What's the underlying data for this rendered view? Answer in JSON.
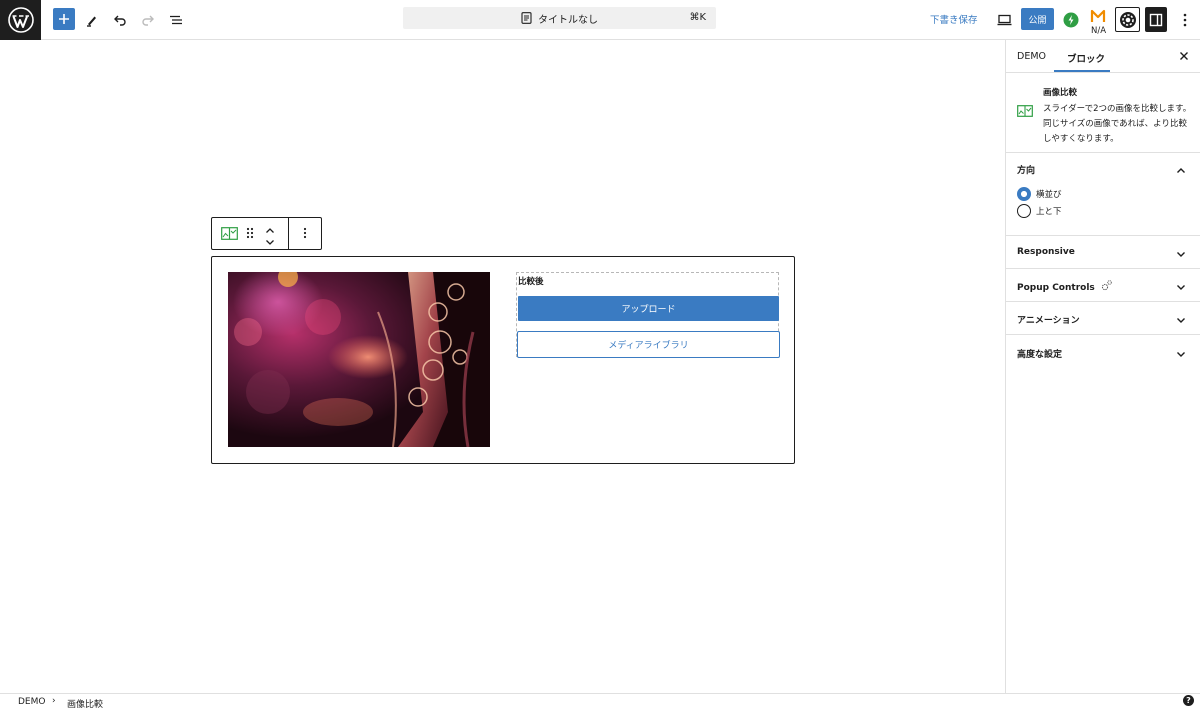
{
  "topbar": {
    "document_title": "タイトルなし",
    "shortcut": "⌘K",
    "save_draft": "下書き保存",
    "publish": "公開",
    "plugin_status": "N/A",
    "icons": [
      "wordpress-logo",
      "plus-icon",
      "pen-icon",
      "undo-icon",
      "redo-icon",
      "list-view-icon",
      "document-icon",
      "desktop-icon",
      "lightning-icon",
      "m-plugin-icon",
      "gear-icon",
      "sidebar-toggle-icon",
      "more-vertical-icon"
    ]
  },
  "block": {
    "after_label": "比較後",
    "upload_button": "アップロード",
    "media_library_button": "メディアライブラリ"
  },
  "sidebar": {
    "tabs": [
      "DEMO",
      "ブロック"
    ],
    "block_card": {
      "title": "画像比較",
      "description": "スライダーで2つの画像を比較します。 同じサイズの画像であれば、より比較しやすくなります。"
    },
    "direction": {
      "title": "方向",
      "options": [
        "横並び",
        "上と下"
      ],
      "selected": "横並び"
    },
    "panels": [
      "Responsive",
      "Popup Controls",
      "アニメーション",
      "高度な設定"
    ]
  },
  "footer": {
    "breadcrumb": [
      "DEMO",
      "画像比較"
    ],
    "separator": "›",
    "help": "?"
  },
  "colors": {
    "accent": "#3a7bc2",
    "dark": "#1e1e1e",
    "border": "#e0e0e0",
    "green": "#2f9e44"
  }
}
